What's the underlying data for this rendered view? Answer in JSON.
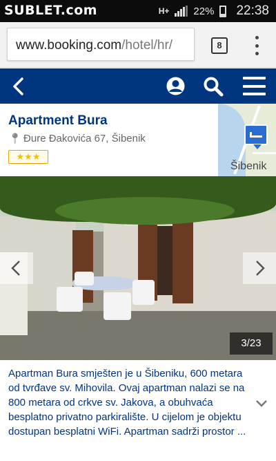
{
  "status_bar": {
    "watermark": "SUBLET.com",
    "network": "H+",
    "battery": "22%",
    "time": "22:38"
  },
  "browser": {
    "url_domain": "www.booking.com",
    "url_path": "/hotel/hr/",
    "tab_count": "8"
  },
  "hotel": {
    "name": "Apartment Bura",
    "address": "Đure Đakovića 67, Šibenik",
    "stars": 3,
    "star_glyphs": "★★★",
    "map_label": "Šibenik"
  },
  "gallery": {
    "counter": "3/23",
    "current": 3,
    "total": 23
  },
  "description": "Apartman Bura smješten je u Šibeniku, 600 metara od tvrđave sv. Mihovila. Ovaj apartman nalazi se na 800 metara od crkve sv. Jakova, a obuhvaća besplatno privatno parkiralište. U cijelom je objektu dostupan besplatni WiFi. Apartman sadrži prostor ...",
  "colors": {
    "brand_blue": "#003580",
    "star_yellow": "#febb02",
    "map_marker": "#2a6ccf"
  },
  "icons": {
    "nav_back": "chevron-left-icon",
    "account": "user-circle-icon",
    "search": "search-icon",
    "menu": "hamburger-icon",
    "address": "map-pin-icon",
    "expand": "chevron-down-icon"
  }
}
